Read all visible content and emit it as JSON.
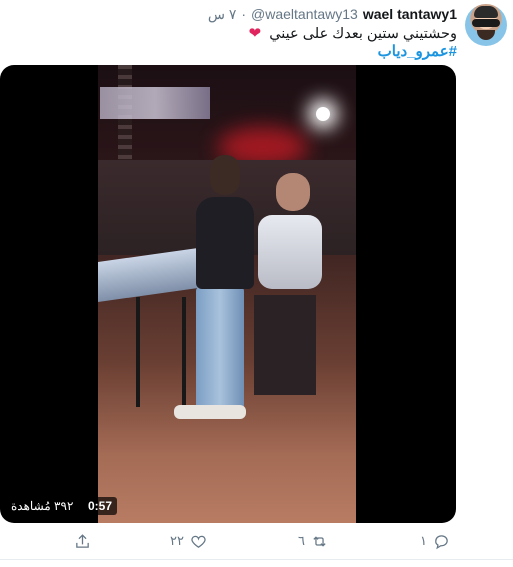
{
  "tweet": {
    "author_name": "wael tantawy1",
    "handle": "@waeltantawy13",
    "separator": "·",
    "time": "٧ س",
    "text": "وحشتيني ستين بعدك على عيني",
    "heart_emoji": "❤",
    "hashtag": "#عمرو_دياب"
  },
  "video": {
    "duration": "0:57",
    "views": "٣٩٢ مُشاهدة"
  },
  "actions": {
    "reply_count": "١",
    "retweet_count": "٦",
    "like_count": "٢٢",
    "share_icon": "share-icon"
  },
  "colors": {
    "accent": "#1b95e0",
    "heart": "#e0245e",
    "muted": "#657786"
  }
}
